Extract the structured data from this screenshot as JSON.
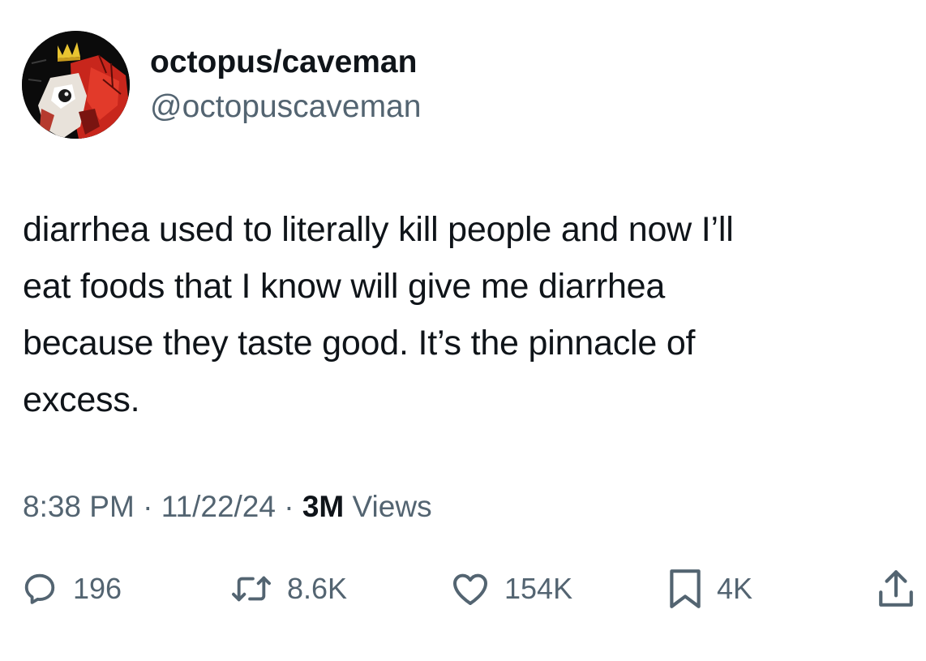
{
  "author": {
    "display_name": "octopus/caveman",
    "handle": "@octopuscaveman",
    "avatar_icon": "avatar-crowned-face-artwork"
  },
  "tweet": {
    "lines": [
      "diarrhea used to literally kill people and now I’ll",
      "eat foods that I know will give me diarrhea",
      "because they taste good. It’s the pinnacle of",
      "excess."
    ]
  },
  "meta": {
    "time": "8:38 PM",
    "separator": " · ",
    "date": "11/22/24",
    "views_count": "3M",
    "views_label": " Views"
  },
  "actions": {
    "reply": {
      "icon": "reply-icon",
      "count": "196"
    },
    "retweet": {
      "icon": "retweet-icon",
      "count": "8.6K"
    },
    "like": {
      "icon": "heart-icon",
      "count": "154K"
    },
    "bookmark": {
      "icon": "bookmark-icon",
      "count": "4K"
    },
    "share": {
      "icon": "share-icon"
    }
  },
  "colors": {
    "text_primary": "#0f1419",
    "text_secondary": "#536471",
    "background": "#ffffff"
  }
}
